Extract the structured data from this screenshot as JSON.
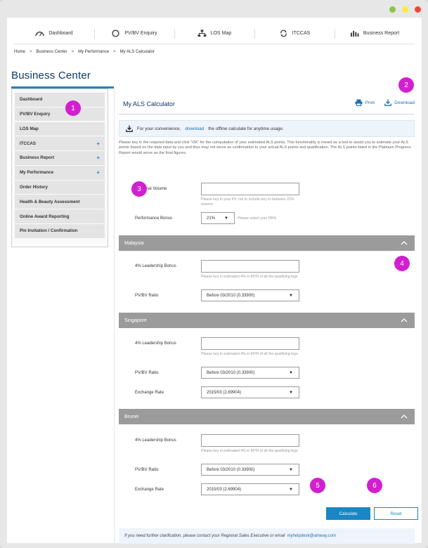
{
  "window": {
    "dot_colors": [
      "#8bc34a",
      "#ffeb3b",
      "#f44336"
    ]
  },
  "topnav": {
    "items": [
      {
        "label": "Dashboard",
        "icon": "dashboard-gauge-icon"
      },
      {
        "label": "PV/BV Enquiry",
        "icon": "circle-icon"
      },
      {
        "label": "LOS Map",
        "icon": "org-chart-icon"
      },
      {
        "label": "ITCCAS",
        "icon": "refresh-icon"
      },
      {
        "label": "Business Report",
        "icon": "bar-chart-icon"
      }
    ]
  },
  "breadcrumb": [
    "Home",
    "Business Center",
    "My Performance",
    "My ALS Calculator"
  ],
  "breadcrumb_separator": ">",
  "page_title": "Business Center",
  "sidebar": {
    "items": [
      {
        "label": "Dashboard",
        "expandable": false
      },
      {
        "label": "PV/BV Enquiry",
        "expandable": false
      },
      {
        "label": "LOS Map",
        "expandable": false
      },
      {
        "label": "ITCCAS",
        "expandable": true
      },
      {
        "label": "Business Report",
        "expandable": true
      },
      {
        "label": "My Performance",
        "expandable": true
      },
      {
        "label": "Order History",
        "expandable": false
      },
      {
        "label": "Health & Beauty Assessment",
        "expandable": false
      },
      {
        "label": "Online Award Reporting",
        "expandable": false
      },
      {
        "label": "Pin Invitation / Confirmation",
        "expandable": false
      }
    ],
    "expand_symbol": "+"
  },
  "main": {
    "title": "My ALS Calculator",
    "print_label": "Print",
    "download_label": "Download",
    "download_notice": {
      "before": "For your convenience,",
      "link": "download",
      "after": "the offline calculate for anytime usage."
    },
    "intro": "Please key in the required data and click \"OK\" for the computation of your estimated ALS points. This functionality is meant as a tool to assist you to estimate your ALS points based on the data input by you and thus may not serve as confirmation to your actual ALS points and qualification. The ALS points listed in the Platinum Progress Report would serve as the final figures.",
    "personal_volume": {
      "label": "Personal Volume",
      "value": "",
      "help": "Please key in your PV, not to include any in-between 21% volume."
    },
    "performance_bonus": {
      "label": "Performance Bonus",
      "value": "21%",
      "help": "Please select your PB%"
    },
    "sections": [
      {
        "name": "Malaysia",
        "leadership_label": "4% Leadership Bonus",
        "leadership_value": "",
        "leadership_help": "Please key in estimated 4% in MYR of all the qualifying legs",
        "pvbv_label": "PV/BV Ratio",
        "pvbv_value": "Before 03/2010 (0.33900)"
      },
      {
        "name": "Singapore",
        "leadership_label": "4% Leadership Bonus",
        "leadership_value": "",
        "leadership_help": "Please key in estimated 4% in MYR of all the qualifying legs",
        "pvbv_label": "PV/BV Ratio",
        "pvbv_value": "Before 03/2010 (0.33900)",
        "exchange_label": "Exchange Rate",
        "exchange_value": "2015/03 (2.69904)"
      },
      {
        "name": "Brunei",
        "leadership_label": "4% Leadership Bonus",
        "leadership_value": "",
        "leadership_help": "Please key in estimated 4% in MYR of all the qualifying legs",
        "pvbv_label": "PV/BV Ratio",
        "pvbv_value": "Before 03/2010 (0.33900)",
        "exchange_label": "Exchange Rate",
        "exchange_value": "2015/03 (2.69904)"
      }
    ],
    "calculate_label": "Calculate",
    "reset_label": "Reset",
    "footer": {
      "text": "If you need further clarification, please contact your Regional Sales Executive or email",
      "email": "myhelpdesk@amway.com"
    }
  },
  "badges": [
    "1",
    "2",
    "3",
    "4",
    "5",
    "6"
  ],
  "colors": {
    "accent": "#1a86c4",
    "title_navy": "#0c3a6a",
    "section_bar": "#9b9b9b",
    "badge": "#d21fd0"
  }
}
